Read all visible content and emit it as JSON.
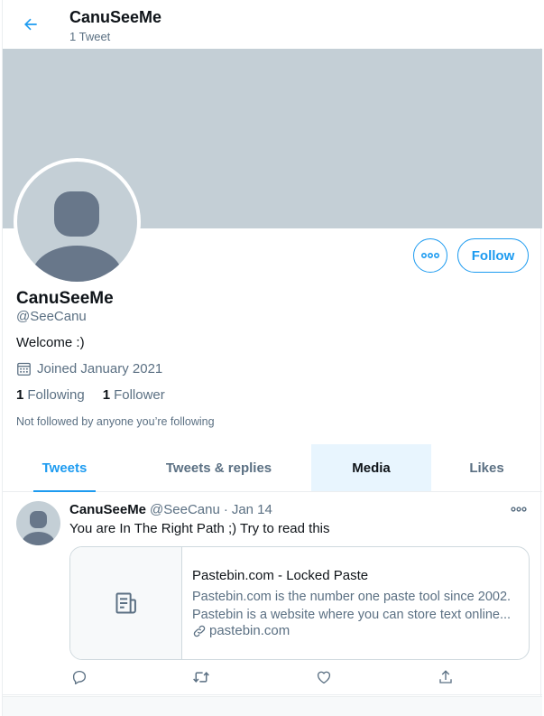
{
  "header": {
    "name": "CanuSeeMe",
    "tweet_count": "1 Tweet"
  },
  "profile": {
    "name": "CanuSeeMe",
    "handle": "@SeeCanu",
    "bio": "Welcome :)",
    "joined": "Joined January 2021",
    "following_count": "1",
    "following_label": "Following",
    "follower_count": "1",
    "follower_label": "Follower",
    "not_followed": "Not followed by anyone you’re following",
    "follow_label": "Follow"
  },
  "tabs": [
    {
      "label": "Tweets",
      "active": true
    },
    {
      "label": "Tweets & replies",
      "active": false
    },
    {
      "label": "Media",
      "active": false
    },
    {
      "label": "Likes",
      "active": false
    }
  ],
  "tweet": {
    "name": "CanuSeeMe",
    "handle": "@SeeCanu",
    "separator": "·",
    "date": "Jan 14",
    "text": "You are In The Right Path ;) Try to read this",
    "card": {
      "title": "Pastebin.com - Locked Paste",
      "desc_line1": "Pastebin.com is the number one paste tool since 2002.",
      "desc_line2": "Pastebin is a website where you can store text online...",
      "link": "pastebin.com"
    }
  },
  "colors": {
    "accent": "#1d9bf0",
    "banner": "#c4cfd6",
    "secondary_text": "#5b7083",
    "avatar_figure": "#68778a"
  },
  "icons": [
    "back-arrow-icon",
    "more-icon",
    "calendar-icon",
    "document-icon",
    "link-icon",
    "reply-icon",
    "retweet-icon",
    "like-icon",
    "share-icon"
  ]
}
